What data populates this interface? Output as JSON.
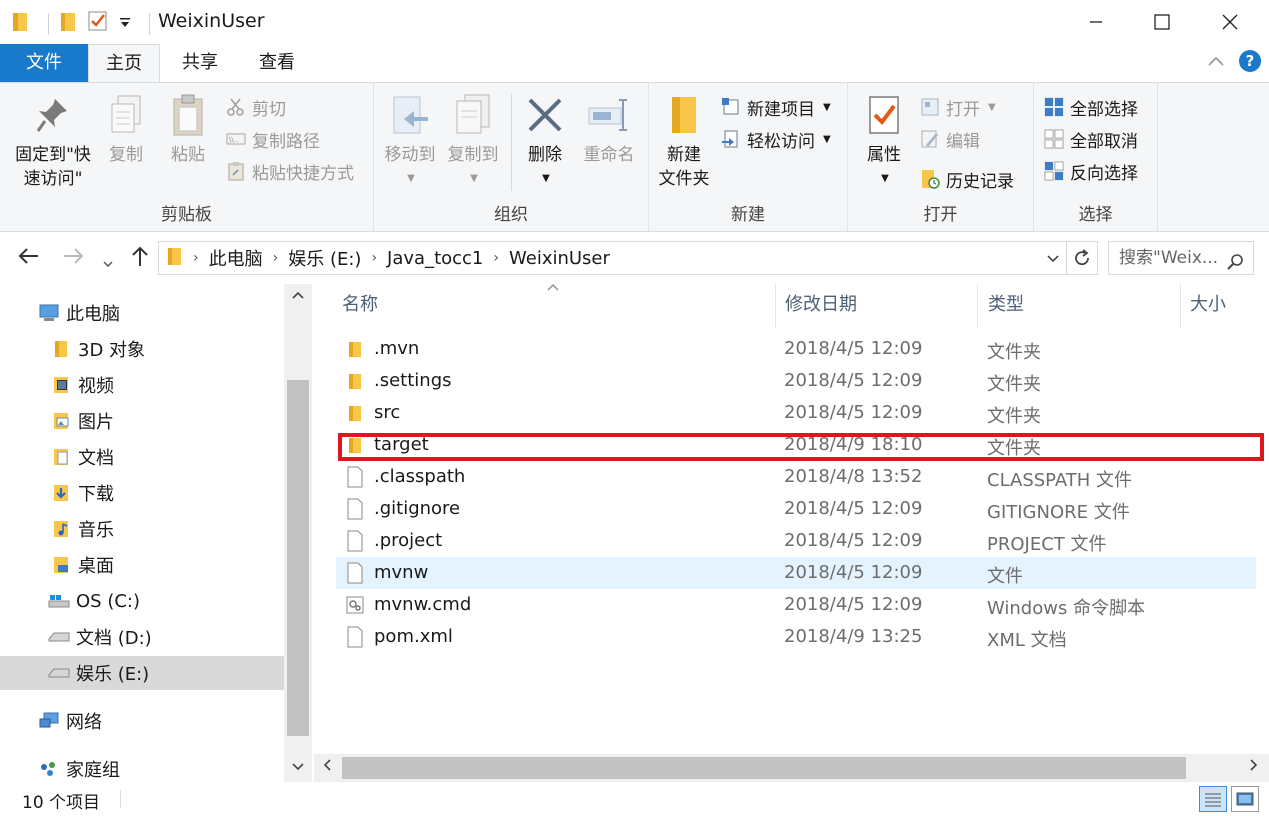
{
  "window": {
    "title": "WeixinUser",
    "minimize_icon": "minimize-icon",
    "maximize_icon": "maximize-icon",
    "close_icon": "close-icon"
  },
  "ribbon_tabs": {
    "file": "文件",
    "home": "主页",
    "share": "共享",
    "view": "查看"
  },
  "ribbon": {
    "clipboard": {
      "label": "剪贴板",
      "pin": "固定到\"快\n速访问\"",
      "pin_line1": "固定到\"快",
      "pin_line2": "速访问\"",
      "copy": "复制",
      "paste": "粘贴",
      "cut": "剪切",
      "copy_path": "复制路径",
      "paste_shortcut": "粘贴快捷方式"
    },
    "organize": {
      "label": "组织",
      "move_to": "移动到",
      "copy_to": "复制到",
      "delete": "删除",
      "rename": "重命名"
    },
    "new": {
      "label": "新建",
      "new_folder_line1": "新建",
      "new_folder_line2": "文件夹",
      "new_item": "新建项目",
      "easy_access": "轻松访问"
    },
    "open": {
      "label": "打开",
      "properties": "属性",
      "open": "打开",
      "edit": "编辑",
      "history": "历史记录"
    },
    "select": {
      "label": "选择",
      "select_all": "全部选择",
      "select_none": "全部取消",
      "invert": "反向选择"
    }
  },
  "address": {
    "crumbs": [
      "此电脑",
      "娱乐 (E:)",
      "Java_tocc1",
      "WeixinUser"
    ],
    "search_placeholder": "搜索\"Weix..."
  },
  "nav_pane": {
    "items": [
      {
        "label": "此电脑",
        "icon": "computer-icon"
      },
      {
        "label": "3D 对象",
        "icon": "folder-3d-icon"
      },
      {
        "label": "视频",
        "icon": "video-folder-icon"
      },
      {
        "label": "图片",
        "icon": "pictures-folder-icon"
      },
      {
        "label": "文档",
        "icon": "documents-folder-icon"
      },
      {
        "label": "下载",
        "icon": "downloads-folder-icon"
      },
      {
        "label": "音乐",
        "icon": "music-folder-icon"
      },
      {
        "label": "桌面",
        "icon": "desktop-folder-icon"
      },
      {
        "label": "OS (C:)",
        "icon": "drive-icon"
      },
      {
        "label": "文档 (D:)",
        "icon": "drive-icon"
      },
      {
        "label": "娱乐 (E:)",
        "icon": "drive-icon"
      },
      {
        "label": "网络",
        "icon": "network-icon"
      },
      {
        "label": "家庭组",
        "icon": "homegroup-icon"
      }
    ]
  },
  "columns": {
    "name": "名称",
    "modified": "修改日期",
    "type": "类型",
    "size": "大小"
  },
  "files": [
    {
      "name": ".mvn",
      "date": "2018/4/5 12:09",
      "type": "文件夹",
      "icon": "folder-icon"
    },
    {
      "name": ".settings",
      "date": "2018/4/5 12:09",
      "type": "文件夹",
      "icon": "folder-icon"
    },
    {
      "name": "src",
      "date": "2018/4/5 12:09",
      "type": "文件夹",
      "icon": "folder-icon"
    },
    {
      "name": "target",
      "date": "2018/4/9 18:10",
      "type": "文件夹",
      "icon": "folder-icon"
    },
    {
      "name": ".classpath",
      "date": "2018/4/8 13:52",
      "type": "CLASSPATH 文件",
      "icon": "file-icon"
    },
    {
      "name": ".gitignore",
      "date": "2018/4/5 12:09",
      "type": "GITIGNORE 文件",
      "icon": "file-icon"
    },
    {
      "name": ".project",
      "date": "2018/4/5 12:09",
      "type": "PROJECT 文件",
      "icon": "file-icon"
    },
    {
      "name": "mvnw",
      "date": "2018/4/5 12:09",
      "type": "文件",
      "icon": "file-icon"
    },
    {
      "name": "mvnw.cmd",
      "date": "2018/4/5 12:09",
      "type": "Windows 命令脚本",
      "icon": "script-file-icon"
    },
    {
      "name": "pom.xml",
      "date": "2018/4/9 13:25",
      "type": "XML 文档",
      "icon": "file-icon"
    }
  ],
  "status": {
    "count": "10 个项目"
  },
  "colors": {
    "accent": "#1979ca",
    "highlight_box": "#e2141e",
    "hover_row": "#e5f3ff",
    "folder": "#f8c74a"
  }
}
